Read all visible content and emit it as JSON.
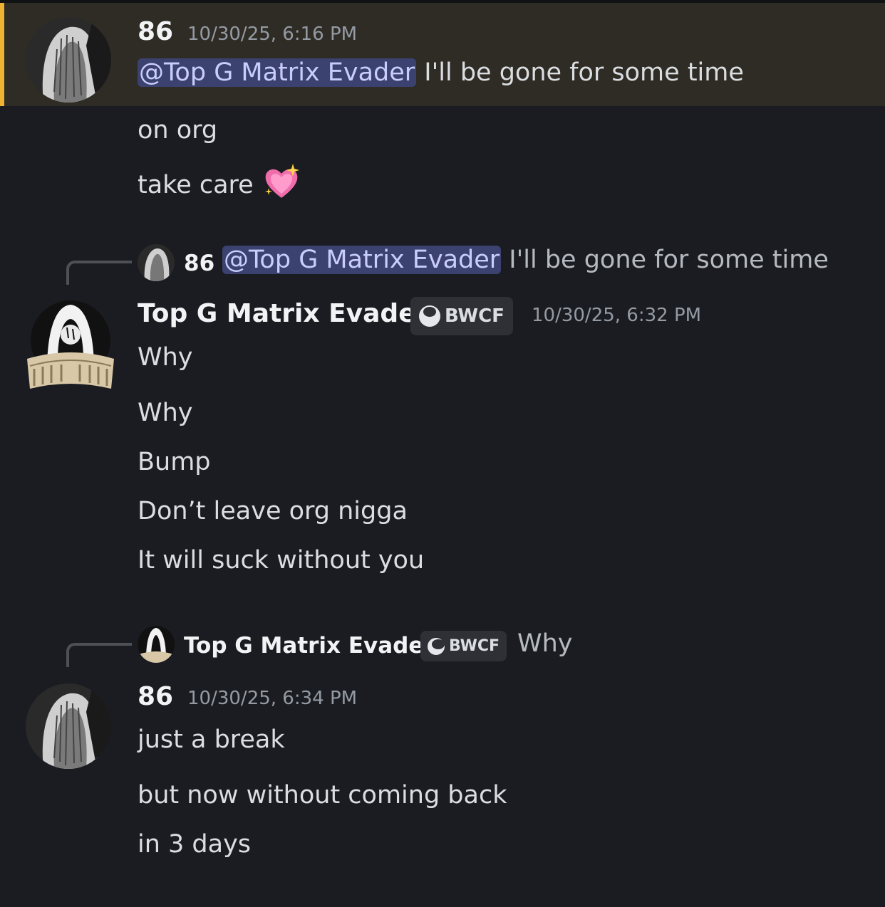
{
  "messages": [
    {
      "author": "86",
      "timestamp": "10/30/25, 6:16 PM",
      "mention": "@Top G Matrix Evader",
      "first_line_text": " I'll be gone for some time",
      "lines": [
        "on org",
        "take care"
      ],
      "emoji": "sparkling-heart"
    },
    {
      "reply": {
        "author": "86",
        "mention": "@Top G Matrix Evader",
        "text": " I'll be gone for some time"
      },
      "author": "Top G Matrix Evader",
      "tag": "BWCF",
      "timestamp": "10/30/25, 6:32 PM",
      "lines": [
        "Why",
        "Why",
        "Bump",
        "Don’t leave org nigga",
        "It will suck without you"
      ]
    },
    {
      "reply": {
        "author": "Top G Matrix Evader",
        "tag": "BWCF",
        "text": "Why"
      },
      "author": "86",
      "timestamp": "10/30/25, 6:34 PM",
      "lines": [
        "just a break",
        "but now without coming back",
        "in 3 days"
      ]
    }
  ],
  "colors": {
    "background": "#1b1c21",
    "mention_highlight_bg": "#2f2b25",
    "mention_bar": "#f0b232",
    "mention_pill": "#3c4270"
  }
}
